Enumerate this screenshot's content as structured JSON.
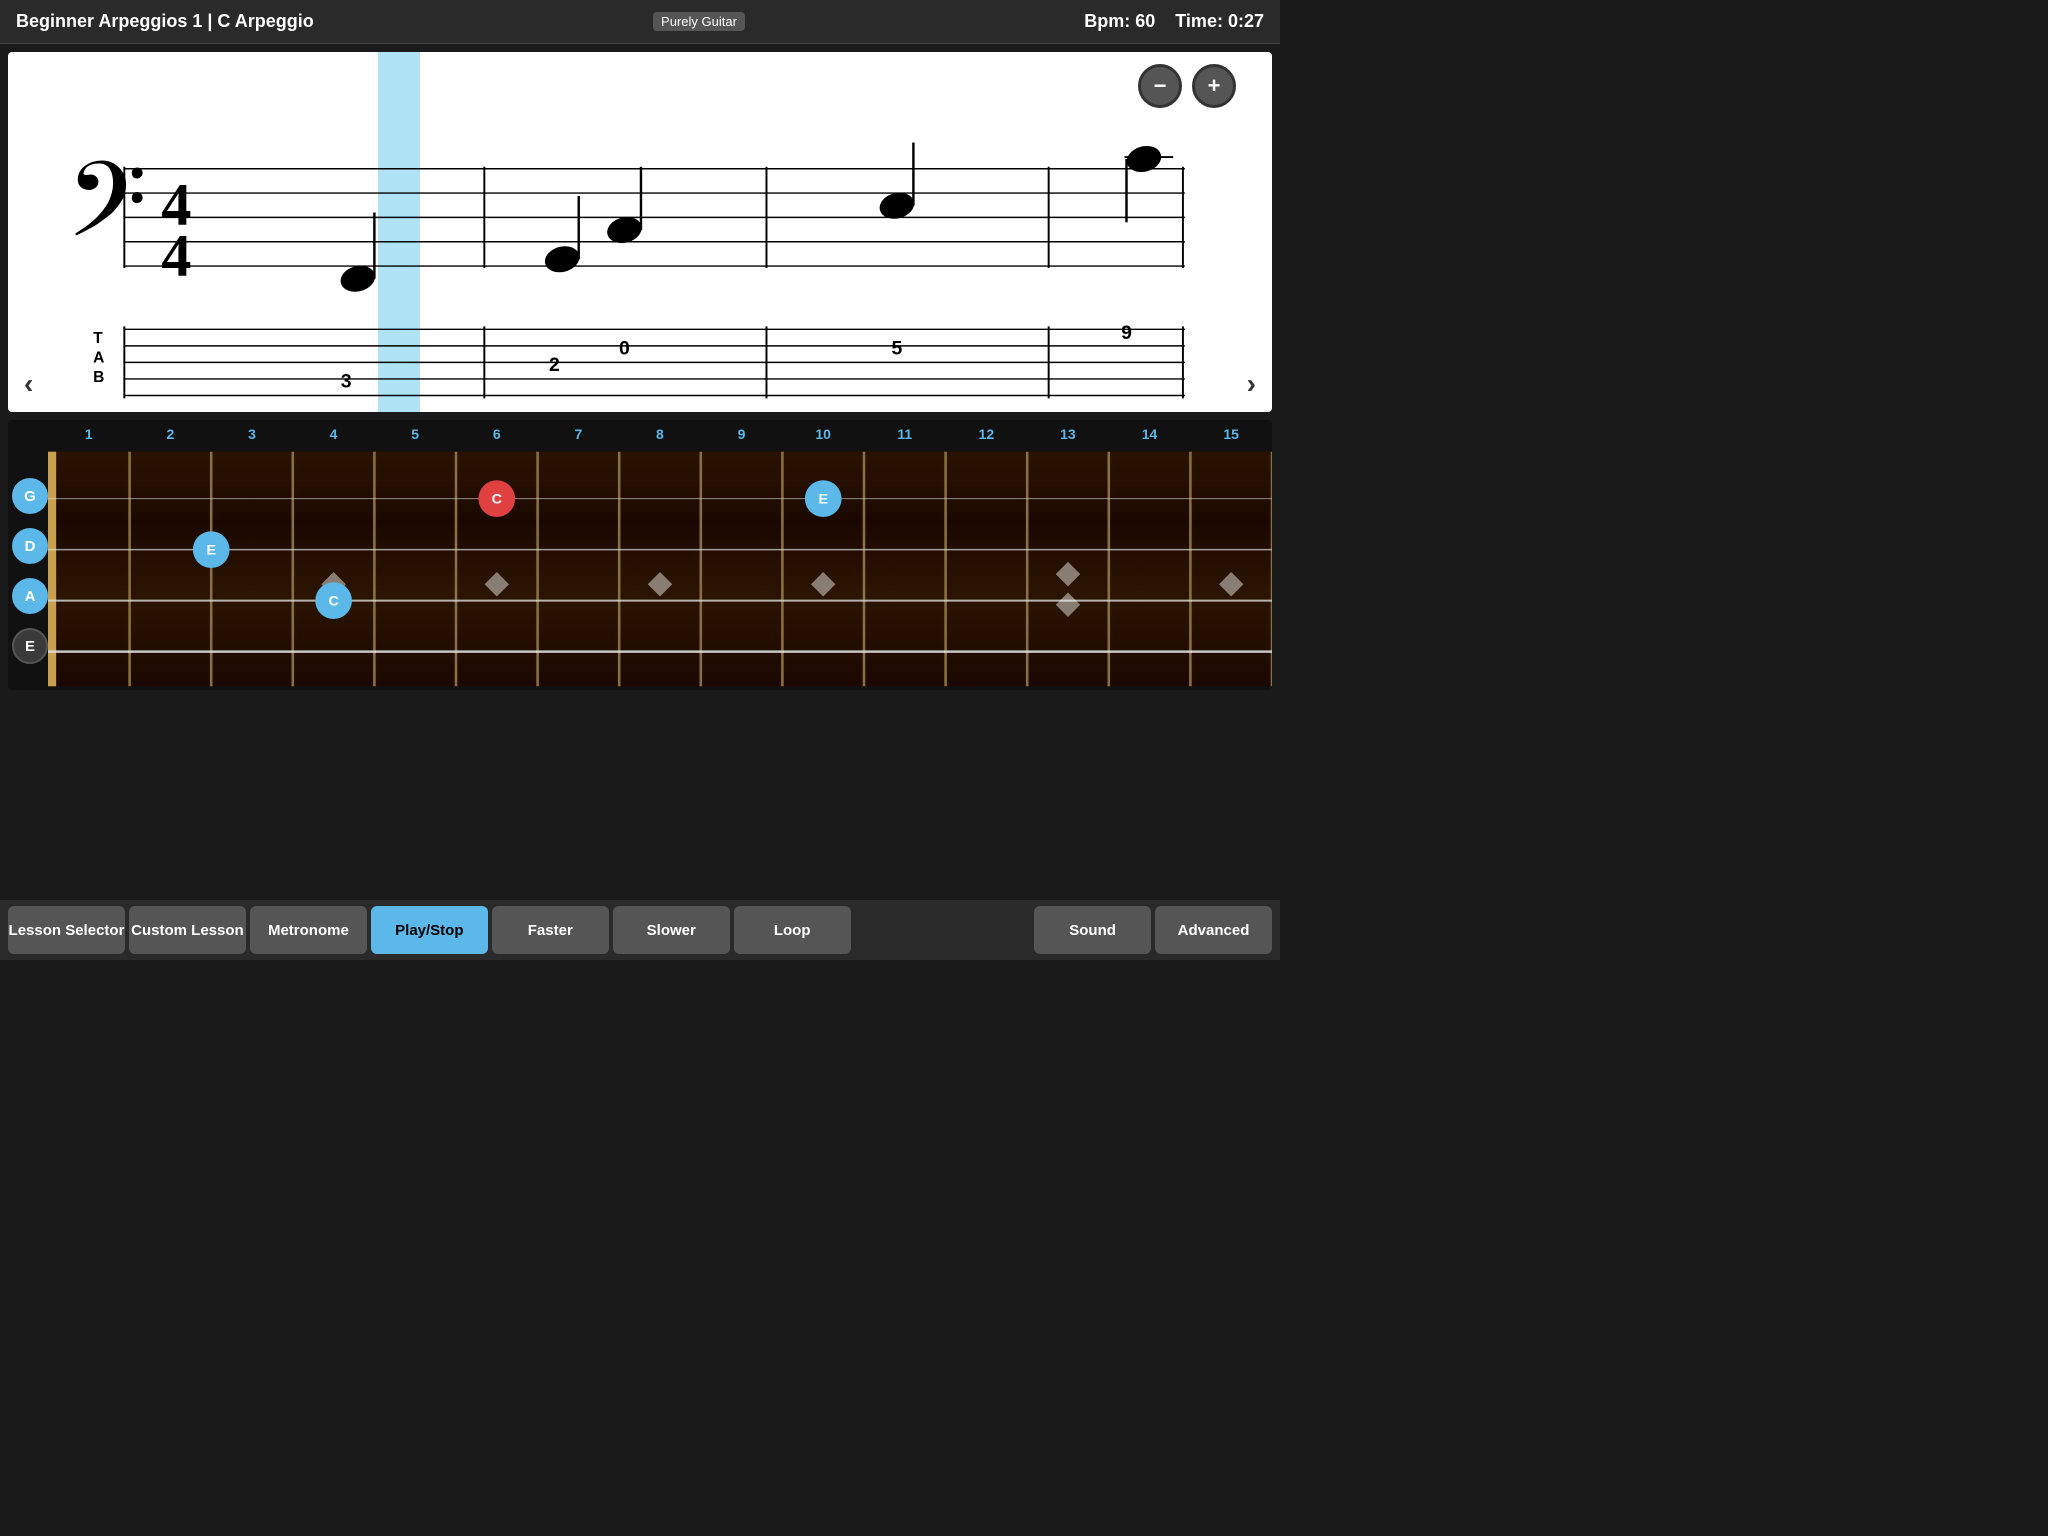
{
  "header": {
    "title": "Beginner Arpeggios 1 | C Arpeggio",
    "logo": "Purely Guitar",
    "bpm_label": "Bpm: 60",
    "time_label": "Time: 0:27"
  },
  "zoom": {
    "minus_label": "−",
    "plus_label": "+"
  },
  "navigation": {
    "left_arrow": "‹",
    "right_arrow": "›"
  },
  "sheet": {
    "clef": "𝄢",
    "time_top": "4",
    "time_bottom": "4",
    "tab_labels": [
      "T",
      "A",
      "B"
    ],
    "tab_numbers": [
      "3",
      "2",
      "0",
      "5",
      "9"
    ]
  },
  "fretboard": {
    "fret_numbers": [
      "1",
      "2",
      "3",
      "4",
      "5",
      "6",
      "7",
      "8",
      "9",
      "10",
      "11",
      "12",
      "13",
      "14",
      "15"
    ],
    "strings": [
      {
        "label": "G",
        "active": true
      },
      {
        "label": "D",
        "active": true
      },
      {
        "label": "A",
        "active": true
      },
      {
        "label": "E",
        "active": false
      }
    ],
    "notes": [
      {
        "string": "G",
        "fret": 5,
        "note": "C",
        "color": "red"
      },
      {
        "string": "G",
        "fret": 9,
        "note": "E",
        "color": "blue"
      },
      {
        "string": "D",
        "fret": 2,
        "note": "E",
        "color": "blue"
      },
      {
        "string": "A",
        "fret": 3,
        "note": "C",
        "color": "blue"
      }
    ]
  },
  "toolbar": {
    "buttons": [
      {
        "label": "Lesson Selector",
        "active": false
      },
      {
        "label": "Custom Lesson",
        "active": false
      },
      {
        "label": "Metronome",
        "active": false
      },
      {
        "label": "Play/Stop",
        "active": true
      },
      {
        "label": "Faster",
        "active": false
      },
      {
        "label": "Slower",
        "active": false
      },
      {
        "label": "Loop",
        "active": false
      },
      {
        "label": "Sound",
        "active": false
      },
      {
        "label": "Advanced",
        "active": false
      }
    ]
  }
}
